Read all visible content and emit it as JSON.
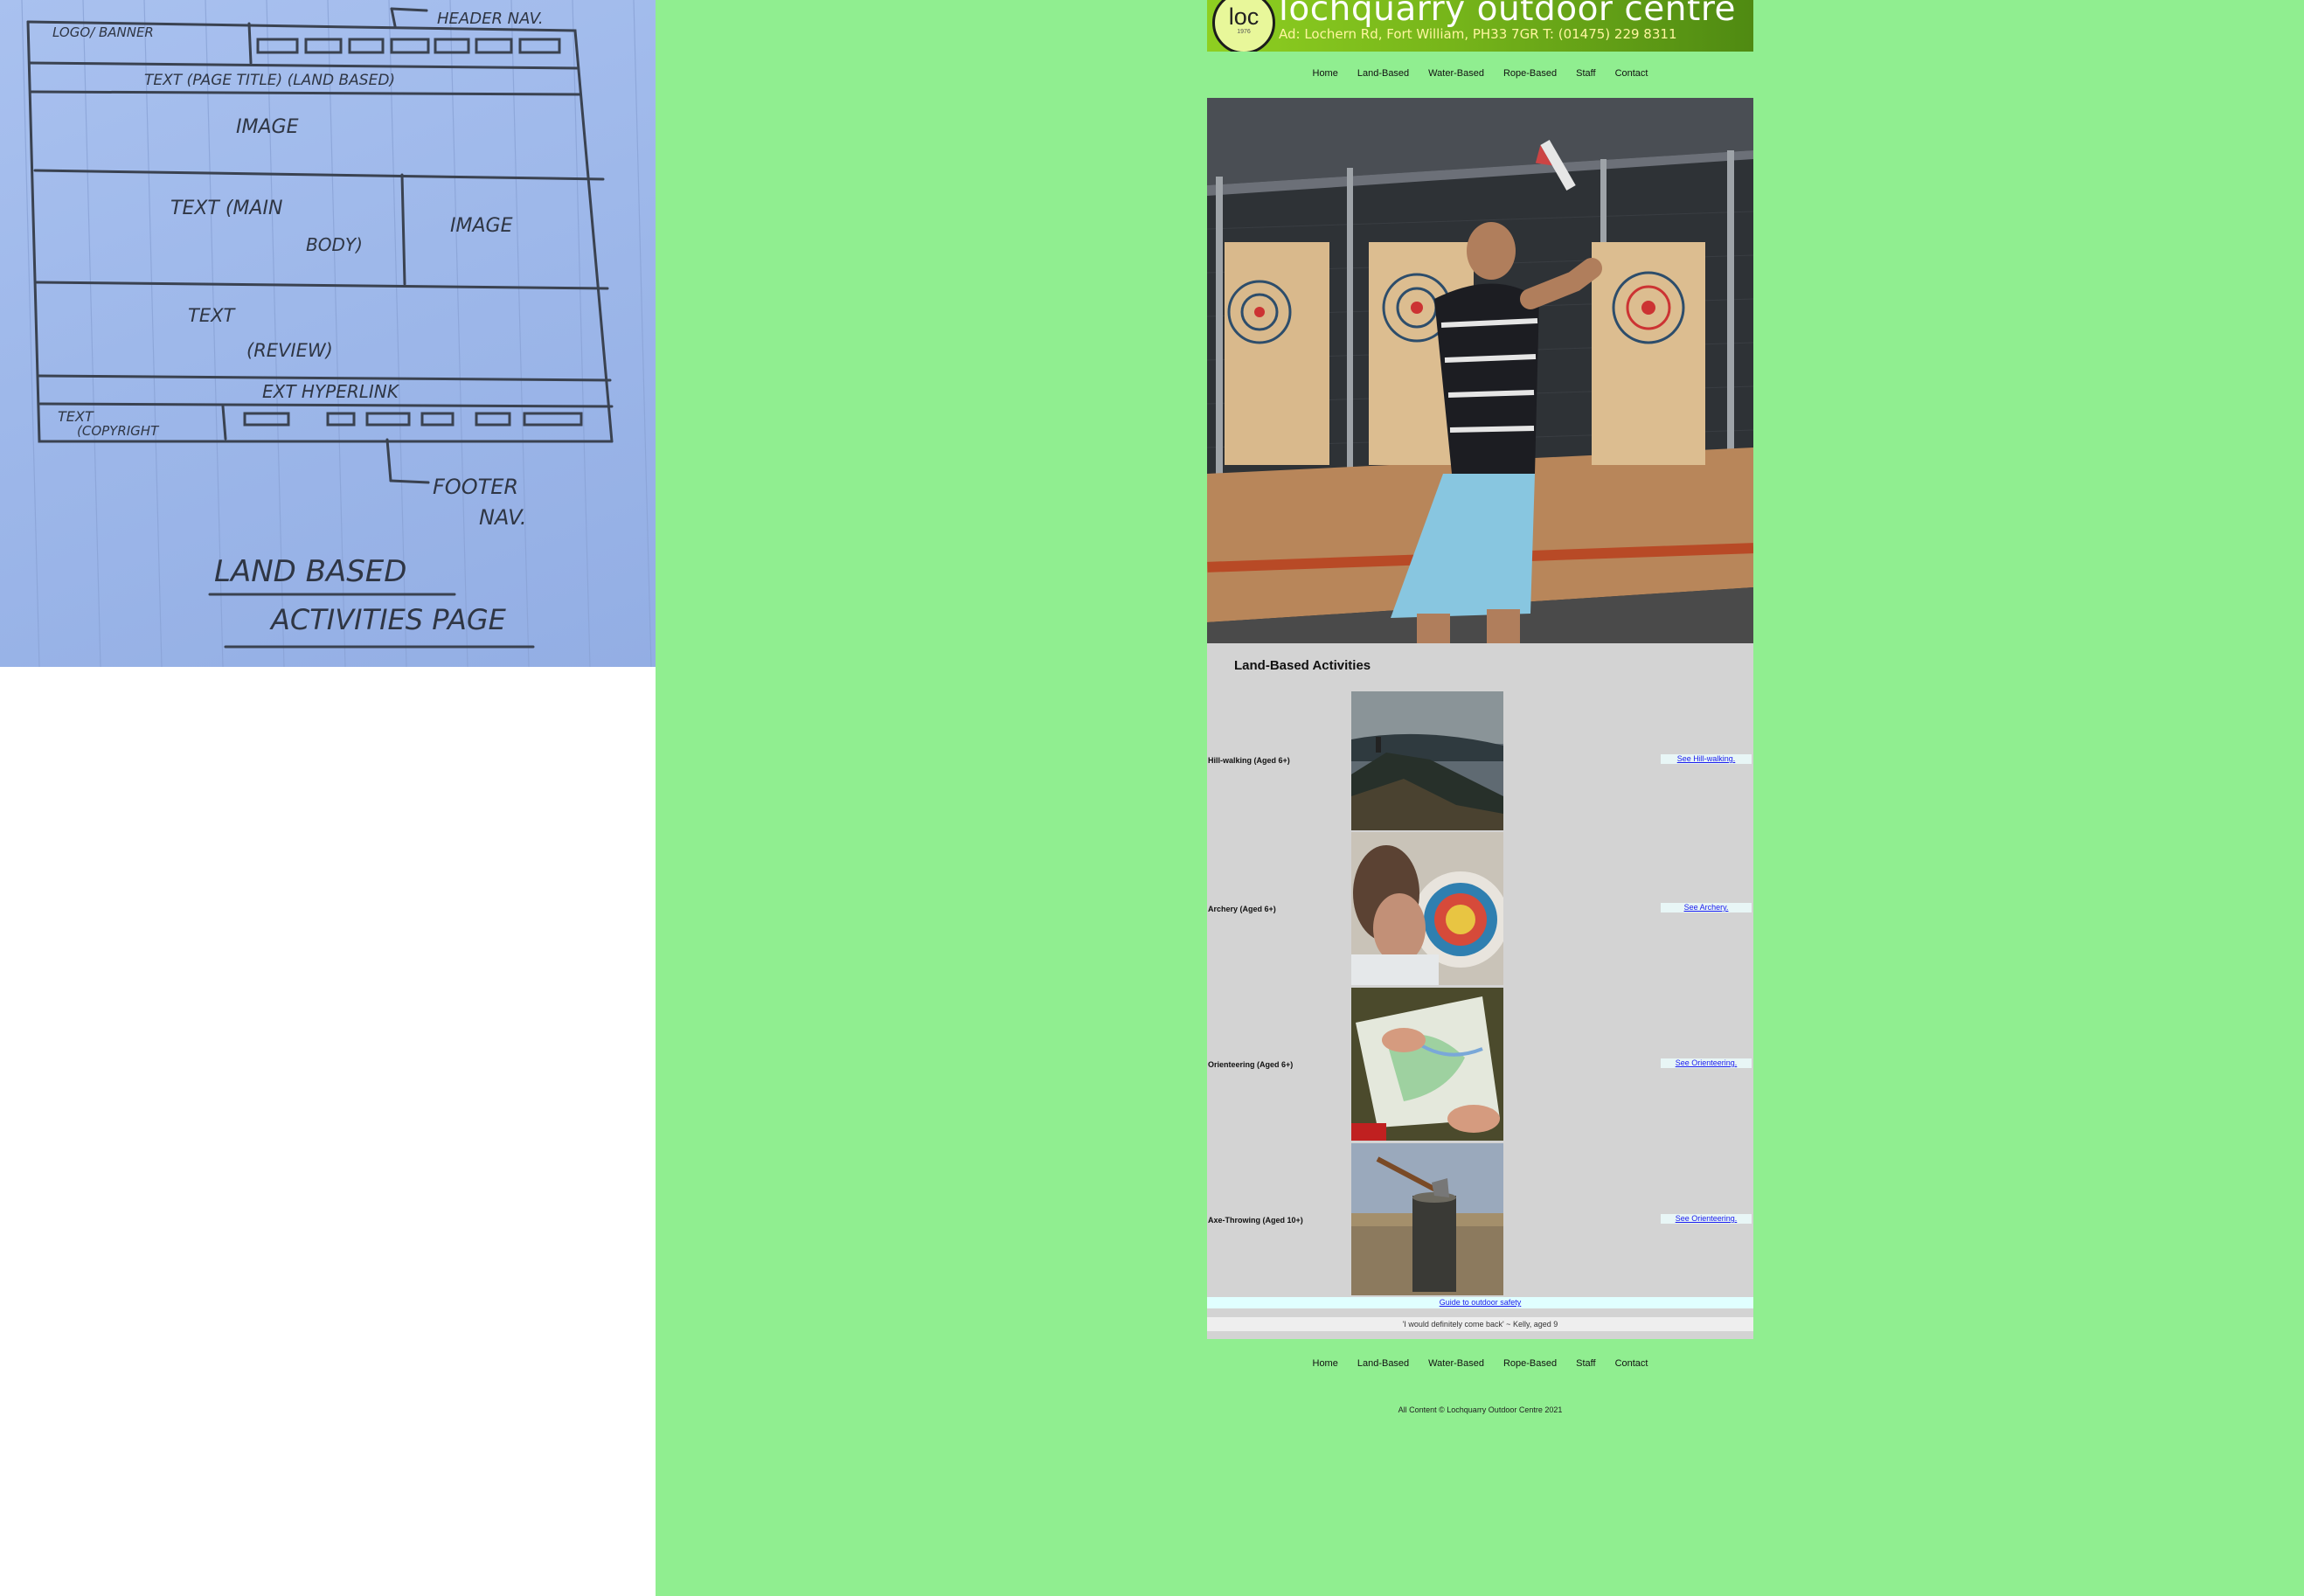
{
  "sketch": {
    "header_nav_note": "HEADER NAV.",
    "logo_banner": "LOGO/ BANNER",
    "page_title_box": "TEXT (PAGE TITLE) (LAND BASED)",
    "image_box": "IMAGE",
    "main_text_box_1": "TEXT (MAIN",
    "main_text_box_2": "BODY)",
    "side_image_box": "IMAGE",
    "review_text_1": "TEXT",
    "review_text_2": "(REVIEW)",
    "ext_link_box": "EXT HYPERLINK",
    "copyright_box_1": "TEXT",
    "copyright_box_2": "(COPYRIGHT",
    "footer_nav_1": "FOOTER",
    "footer_nav_2": "NAV.",
    "page_caption_1": "LAND BASED",
    "page_caption_2": "ACTIVITIES PAGE"
  },
  "site": {
    "logo_main": "loc",
    "logo_sub": "1976",
    "title": "lochquarry outdoor centre",
    "address": "Ad: Lochern Rd, Fort William, PH33 7GR T: (01475) 229 8311",
    "nav": [
      "Home",
      "Land-Based",
      "Water-Based",
      "Rope-Based",
      "Staff",
      "Contact"
    ],
    "content_title": "Land-Based Activities",
    "activities": [
      {
        "label": "Hill-walking (Aged 6+)",
        "link": "See Hill-walking."
      },
      {
        "label": "Archery (Aged 6+)",
        "link": "See Archery."
      },
      {
        "label": "Orienteering (Aged 6+)",
        "link": "See Orienteering."
      },
      {
        "label": "Axe-Throwing (Aged 10+)",
        "link": "See Orienteering."
      }
    ],
    "safety_link": "Guide to outdoor safety",
    "review": "'I would definitely come back' ~ Kelly, aged 9",
    "copyright": "All Content © Lochquarry Outdoor Centre 2021"
  },
  "colors": {
    "page_background": "#90ee90",
    "content_background": "#d3d3d3",
    "link": "#1a1aee"
  }
}
